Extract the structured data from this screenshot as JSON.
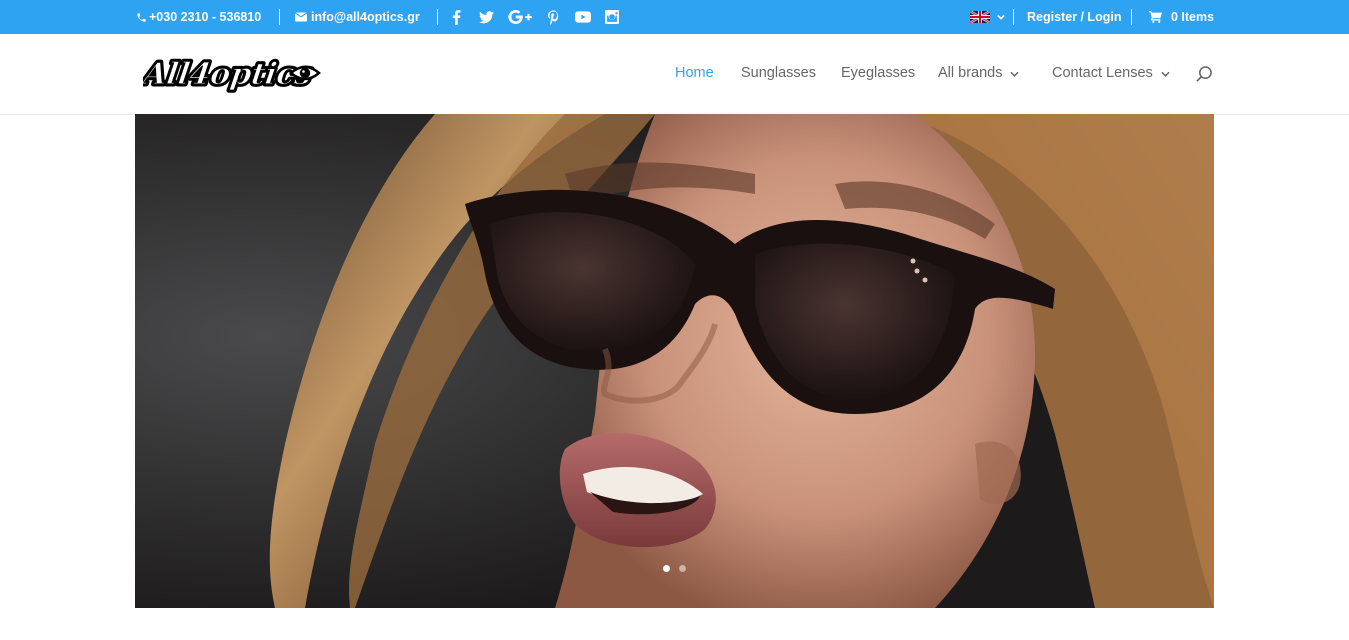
{
  "topbar": {
    "phone": "+030 2310 - 536810",
    "email": "info@all4optics.gr",
    "social_icons": [
      "facebook-icon",
      "twitter-icon",
      "google-plus-icon",
      "pinterest-icon",
      "youtube-icon",
      "instagram-icon"
    ],
    "language_icon": "uk-flag-icon",
    "register_login": "Register / Login",
    "cart": "0 Items",
    "color": "#2ea3f2"
  },
  "header": {
    "logo_text": "All4optics",
    "nav": [
      {
        "label": "Home",
        "active": true
      },
      {
        "label": "Sunglasses"
      },
      {
        "label": "Eyeglasses"
      },
      {
        "label": "All brands",
        "dropdown": true
      },
      {
        "label": "Contact Lenses",
        "dropdown": true
      }
    ],
    "search_icon": "search-icon"
  },
  "slider": {
    "slide_count": 2,
    "active_slide": 1
  }
}
